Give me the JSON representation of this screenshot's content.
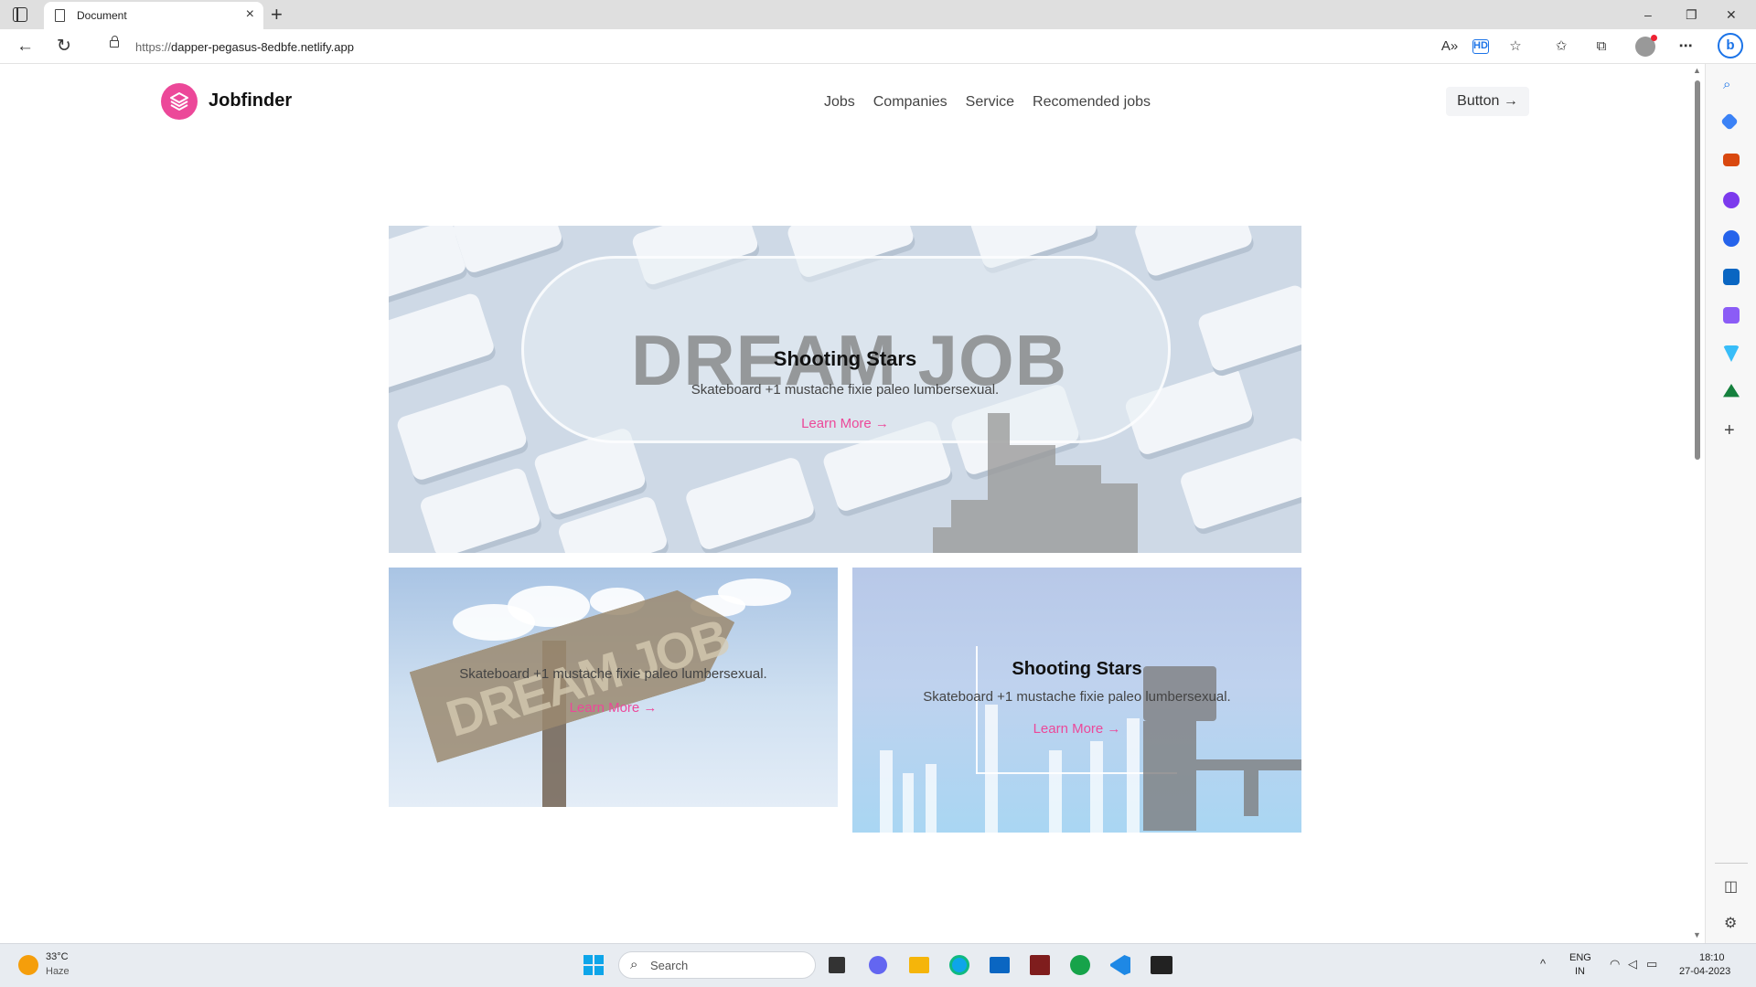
{
  "browser": {
    "tab_title": "Document",
    "url_proto": "https://",
    "url_host": "dapper-pegasus-8edbfe.netlify.app",
    "window_controls": [
      "–",
      "❐",
      "✕"
    ]
  },
  "site": {
    "brand": "Jobfinder",
    "nav": [
      "Jobs",
      "Companies",
      "Service",
      "Recomended jobs"
    ],
    "nav_button": "Button →"
  },
  "cards": {
    "hero": {
      "title": "Shooting Stars",
      "desc": "Skateboard +1 mustache fixie paleo lumbersexual.",
      "link": "Learn More →",
      "image_text": "DREAM JOB"
    },
    "sign": {
      "desc": "Skateboard +1 mustache fixie paleo lumbersexual.",
      "link": "Learn More →",
      "image_text": "DREAM JOB"
    },
    "chart": {
      "title": "Shooting Stars",
      "desc": "Skateboard +1 mustache fixie paleo lumbersexual.",
      "link": "Learn More →"
    }
  },
  "taskbar": {
    "weather_temp": "33°C",
    "weather_desc": "Haze",
    "search_placeholder": "Search",
    "lang_1": "ENG",
    "lang_2": "IN",
    "time": "18:10",
    "date": "27-04-2023"
  },
  "colors": {
    "accent": "#ec4899",
    "taskbar_bg": "#e8ecf1"
  }
}
